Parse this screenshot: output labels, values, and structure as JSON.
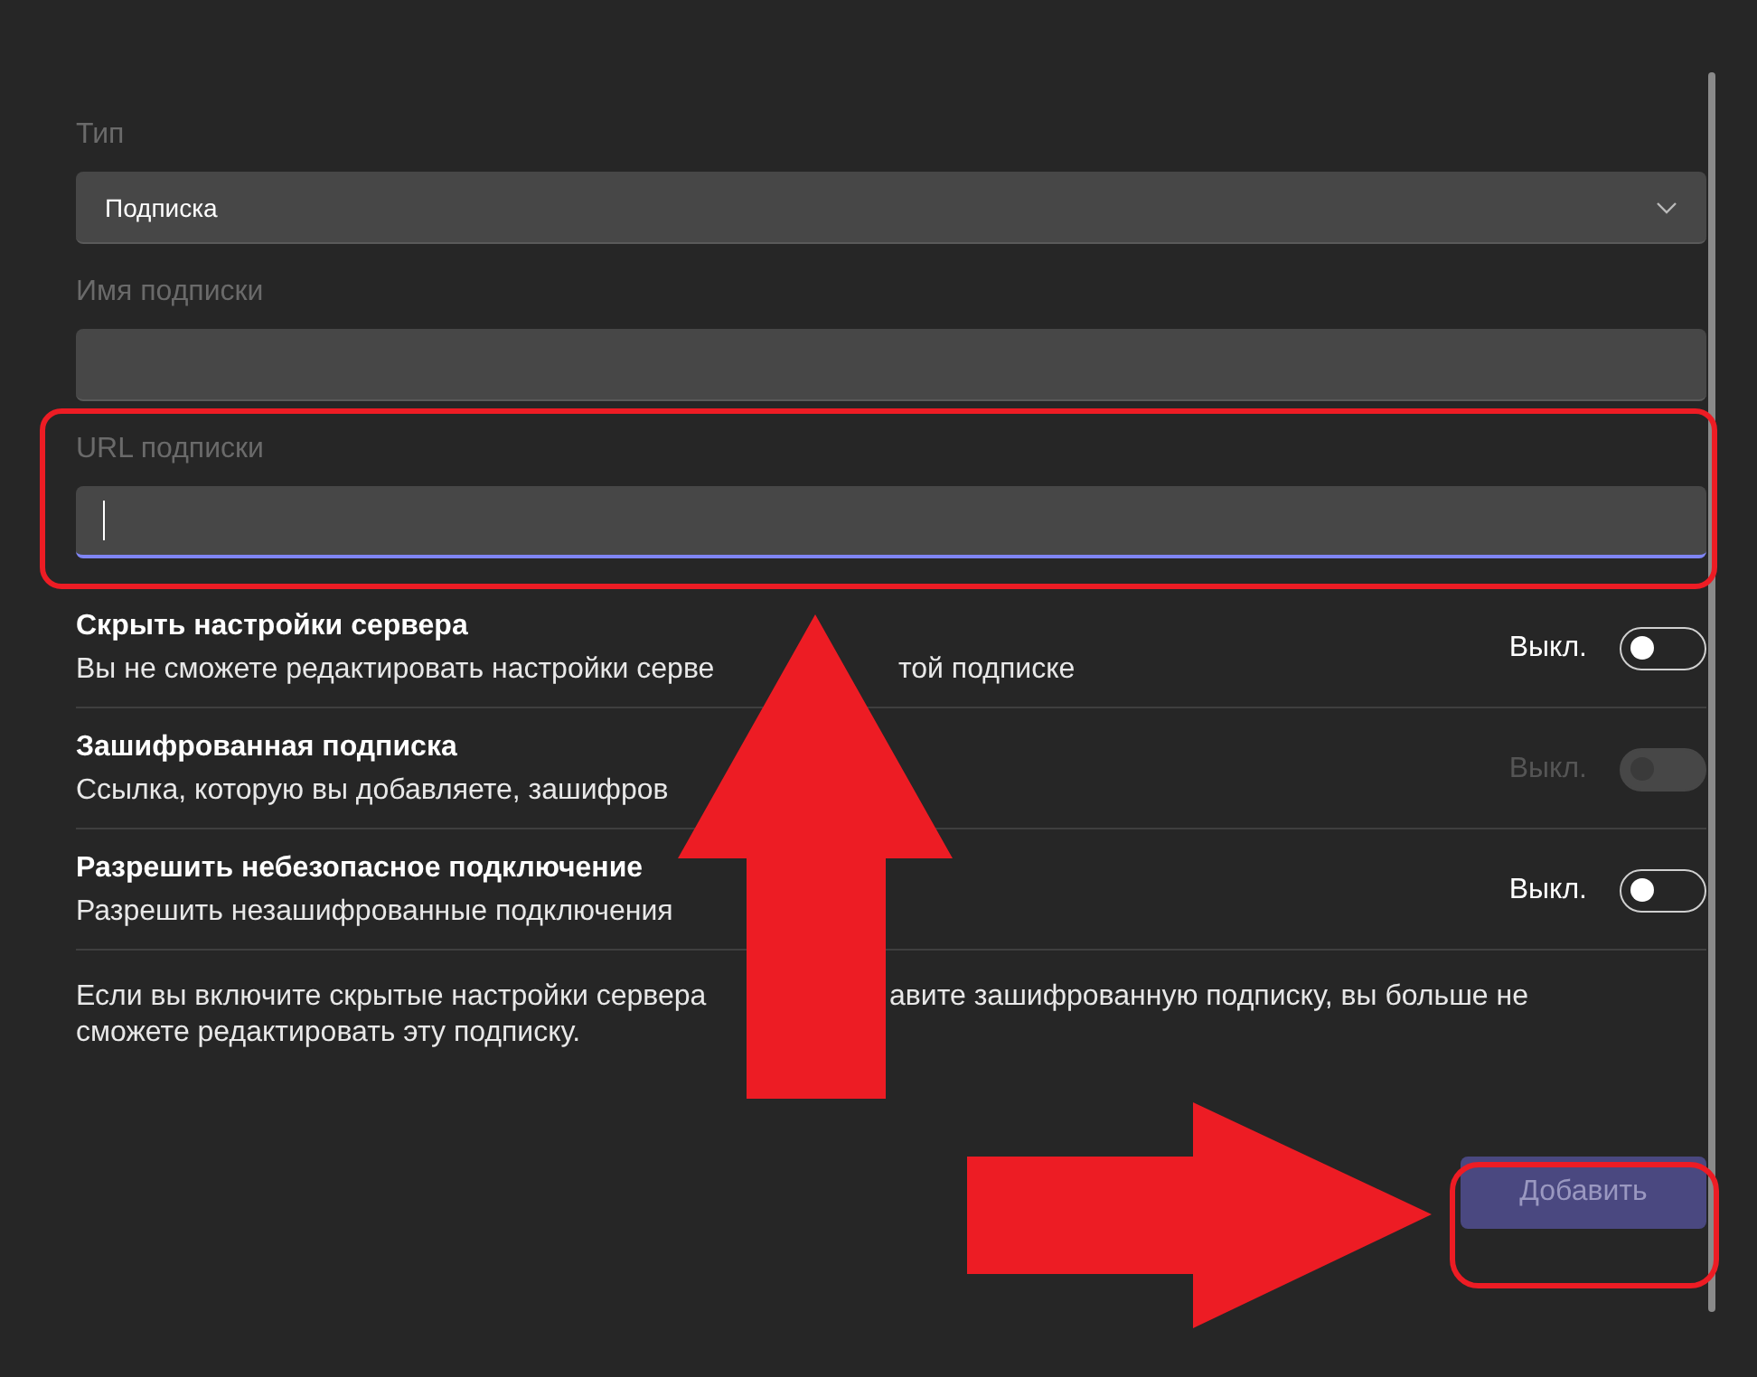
{
  "fields": [
    {
      "kind": "select",
      "label": "Тип",
      "value": "Подписка",
      "focused": false
    },
    {
      "kind": "text",
      "label": "Имя подписки",
      "focused": false
    },
    {
      "kind": "text",
      "label": "URL подписки",
      "focused": true
    }
  ],
  "settings": [
    {
      "title": "Скрыть настройки сервера",
      "description": [
        "Вы не сможете редактировать настройки серве",
        "той подписке"
      ],
      "state": "Выкл.",
      "on": false,
      "disabled": false
    },
    {
      "title": "Зашифрованная подписка",
      "description": [
        "Ссылка, которую вы добавляете, зашифров"
      ],
      "state": "Выкл.",
      "on": false,
      "disabled": true
    },
    {
      "title": "Разрешить небезопасное подключение",
      "description": [
        "Разрешить незашифрованные подключения"
      ],
      "state": "Выкл.",
      "on": false,
      "disabled": false
    }
  ],
  "note": {
    "line_1": [
      "Если вы включите скрытые настройки сервера",
      "авите зашифрованную подписку, вы больше не"
    ],
    "line_2": "сможете редактировать эту подписку."
  },
  "add_button": {
    "label": "Добавить",
    "disabled": true
  },
  "annotations": [
    {
      "kind": "highlight"
    },
    {
      "kind": "arrow_up"
    },
    {
      "kind": "arrow_right"
    },
    {
      "kind": "highlight_button"
    }
  ]
}
